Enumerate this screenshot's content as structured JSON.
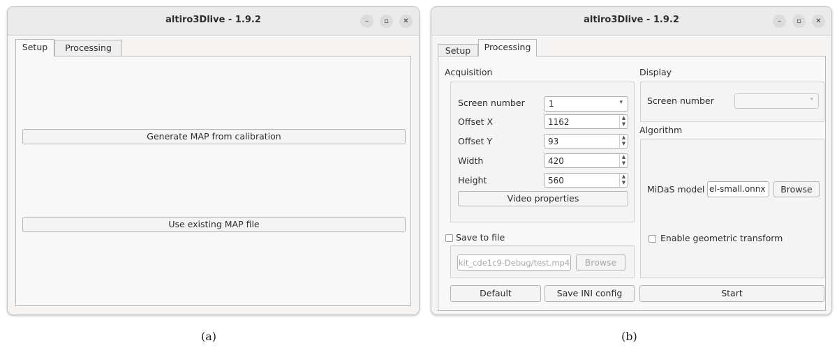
{
  "panel_a": {
    "window_title": "altiro3Dlive - 1.9.2",
    "window_controls": {
      "minimize": "–",
      "maximize": "▫",
      "close": "✕"
    },
    "tabs": [
      {
        "label": "Setup",
        "active": true
      },
      {
        "label": "Processing",
        "active": false
      }
    ],
    "generate_map_label": "Generate MAP from calibration",
    "use_existing_label": "Use existing MAP file",
    "caption": "(a)"
  },
  "panel_b": {
    "window_title": "altiro3Dlive - 1.9.2",
    "window_controls": {
      "minimize": "–",
      "maximize": "▫",
      "close": "✕"
    },
    "tabs": [
      {
        "label": "Setup",
        "active": false
      },
      {
        "label": "Processing",
        "active": true
      }
    ],
    "acquisition": {
      "title": "Acquisition",
      "screen_number_label": "Screen number",
      "screen_number_value": "1",
      "offset_x_label": "Offset X",
      "offset_x_value": "1162",
      "offset_y_label": "Offset Y",
      "offset_y_value": "93",
      "width_label": "Width",
      "width_value": "420",
      "height_label": "Height",
      "height_value": "560",
      "video_properties_label": "Video properties"
    },
    "save_to_file": {
      "label": "Save to file",
      "checked": false,
      "path_value": "kit_cde1c9-Debug/test.mp4",
      "browse_label": "Browse"
    },
    "display": {
      "title": "Display",
      "screen_number_label": "Screen number",
      "screen_number_value": ""
    },
    "algorithm": {
      "title": "Algorithm",
      "midas_label": "MiDaS model",
      "midas_value": "el-small.onnx",
      "browse_label": "Browse",
      "geometric_label": "Enable geometric transform",
      "geometric_checked": false
    },
    "default_label": "Default",
    "save_ini_label": "Save INI config",
    "start_label": "Start",
    "caption": "(b)"
  }
}
